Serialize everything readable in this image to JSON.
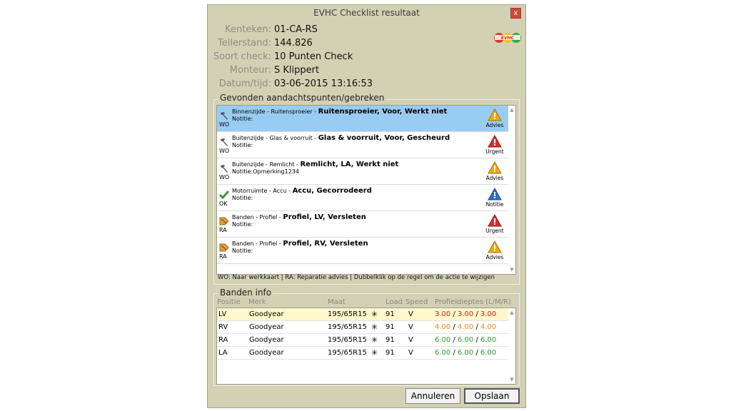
{
  "window": {
    "title": "EVHC Checklist resultaat",
    "close_label": "x"
  },
  "info": [
    {
      "label": "Kenteken:",
      "value": "01-CA-RS"
    },
    {
      "label": "Tellerstand:",
      "value": "144.826"
    },
    {
      "label": "Soort check:",
      "value": "10 Punten Check"
    },
    {
      "label": "Monteur:",
      "value": "S Klippert"
    },
    {
      "label": "Datum/tijd:",
      "value": "03-06-2015 13:16:53"
    }
  ],
  "findings": {
    "title": "Gevonden aandachtspunten/gebreken",
    "items": [
      {
        "prefix": "Binnenzijde - Ruitensproeier - ",
        "title": "Ruitensproeier, Voor, Werkt niet",
        "note": "Notitie:",
        "code": "WO",
        "icon": "hammer-icon",
        "status": "Advies",
        "status_color": "#f0a818"
      },
      {
        "prefix": "Buitenzijde - Glas & voorruit - ",
        "title": "Glas & voorruit, Voor, Gescheurd",
        "note": "Notitie:",
        "code": "WO",
        "icon": "hammer-icon",
        "status": "Urgent",
        "status_color": "#d83030"
      },
      {
        "prefix": "Buitenzijde - Remlicht - ",
        "title": "Remlicht, LA, Werkt niet",
        "note": "Notitie:Opmerking1234",
        "code": "WO",
        "icon": "hammer-icon",
        "status": "Advies",
        "status_color": "#f0a818"
      },
      {
        "prefix": "Motorruimte - Accu - ",
        "title": "Accu, Gecorrodeerd",
        "note": "Notitie:",
        "code": "OK",
        "icon": "checkmark-icon",
        "status": "Notitie",
        "status_color": "#2c6fd0"
      },
      {
        "prefix": "Banden - Profiel - ",
        "title": "Profiel, LV, Versleten",
        "note": "Notitie:",
        "code": "RA",
        "icon": "tag-icon",
        "status": "Urgent",
        "status_color": "#d83030"
      },
      {
        "prefix": "Banden - Profiel - ",
        "title": "Profiel, RV, Versleten",
        "note": "Notitie:",
        "code": "RA",
        "icon": "tag-icon",
        "status": "Advies",
        "status_color": "#f0a818"
      }
    ],
    "legend": "WO: Naar werkkaart | RA: Reparatie advies | Dubbelklik op de regel om de actie te wijzigen"
  },
  "tyres": {
    "title": "Banden info",
    "headers": {
      "positie": "Positie",
      "merk": "Merk",
      "maat": "Maat",
      "load": "Load",
      "speed": "Speed",
      "profiel": "Profieldieptes (L/M/R)"
    },
    "rows": [
      {
        "positie": "LV",
        "merk": "Goodyear",
        "maat": "195/65R15",
        "load": "91",
        "speed": "V",
        "p1": "3.00",
        "p2": "3.00",
        "p3": "3.00",
        "c1": "#d02010",
        "c2": "#d02010",
        "c3": "#d02010"
      },
      {
        "positie": "RV",
        "merk": "Goodyear",
        "maat": "195/65R15",
        "load": "91",
        "speed": "V",
        "p1": "4.00",
        "p2": "4.00",
        "p3": "4.00",
        "c1": "#e08a1a",
        "c2": "#e08a1a",
        "c3": "#e08a1a"
      },
      {
        "positie": "RA",
        "merk": "Goodyear",
        "maat": "195/65R15",
        "load": "91",
        "speed": "V",
        "p1": "6.00",
        "p2": "6.00",
        "p3": "6.00",
        "c1": "#2e9a2e",
        "c2": "#2e9a2e",
        "c3": "#2e9a2e"
      },
      {
        "positie": "LA",
        "merk": "Goodyear",
        "maat": "195/65R15",
        "load": "91",
        "speed": "V",
        "p1": "6.00",
        "p2": "6.00",
        "p3": "6.00",
        "c1": "#2e9a2e",
        "c2": "#2e9a2e",
        "c3": "#2e9a2e"
      }
    ]
  },
  "buttons": {
    "cancel": "Annuleren",
    "save": "Opslaan"
  }
}
